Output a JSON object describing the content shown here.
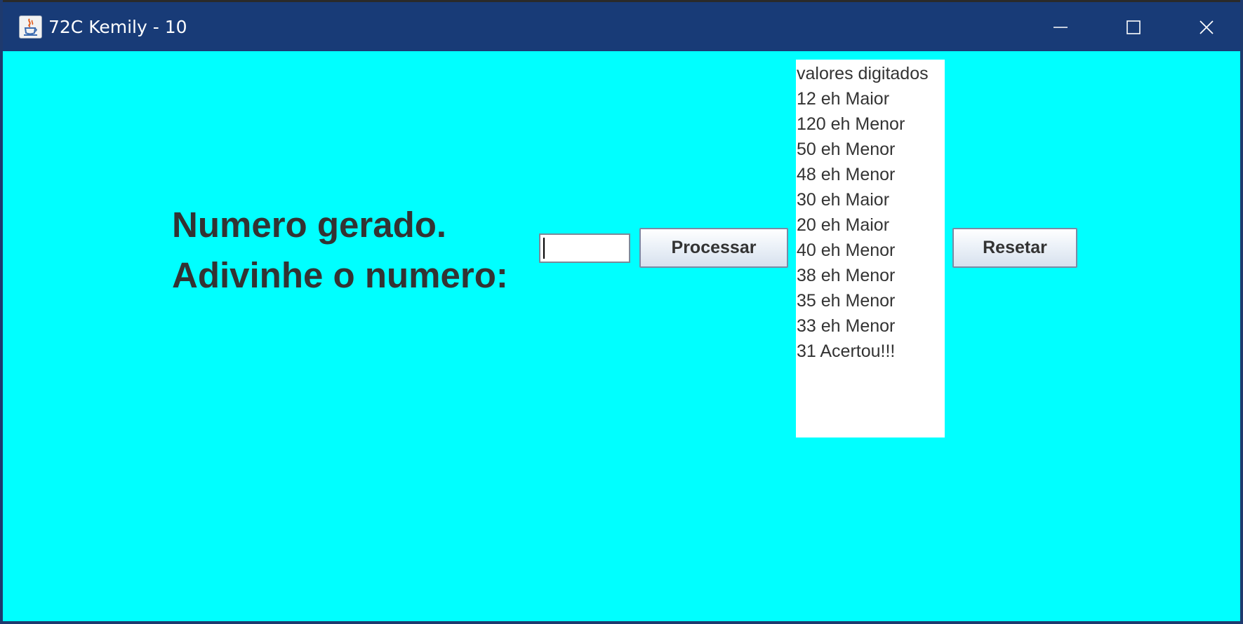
{
  "window": {
    "title": "72C Kemily - 10"
  },
  "icons": {
    "app": "java-cup-icon",
    "minimize": "minimize-icon",
    "maximize": "maximize-icon",
    "close": "close-icon"
  },
  "colors": {
    "titlebar": "#183b77",
    "background": "#00ffff",
    "text": "#333333"
  },
  "main": {
    "label_line1": "Numero gerado.",
    "label_line2": "Adivinhe o numero:",
    "input_value": "",
    "process_button": "Processar",
    "reset_button": "Resetar"
  },
  "history": {
    "lines": [
      "valores digitados",
      "12 eh Maior",
      "120 eh Menor",
      "50 eh Menor",
      "48 eh Menor",
      "30 eh Maior",
      "20 eh Maior",
      "40 eh Menor",
      "38 eh Menor",
      "35 eh Menor",
      "33 eh Menor",
      "31 Acertou!!!"
    ]
  }
}
